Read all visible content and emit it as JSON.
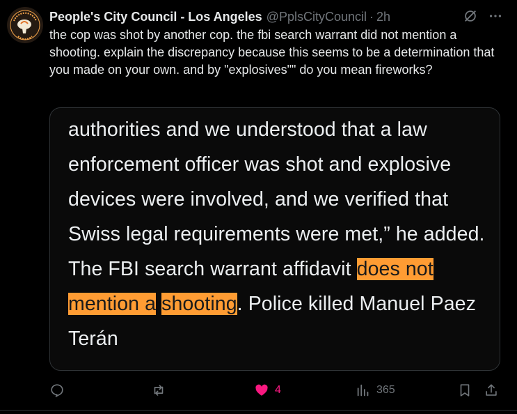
{
  "tweet": {
    "author_name": "People's City Council - Los Angeles",
    "handle": "@PplsCityCouncil",
    "separator": "·",
    "time": "2h",
    "avatar_text_top": "PEOPLE'S CITY COUNCIL",
    "avatar_text_bottom": "LOS ANGELES",
    "body": "the cop was shot by another cop. the fbi search warrant did not mention a shooting. explain the discrepancy because this seems to be a determination that you made on your own. and by \"explosives\"\" do you mean fireworks?"
  },
  "media": {
    "before": "authorities and we understood that a law enforcement officer was shot and explosive devices were involved, and we verified that Swiss legal requirements were met,” he added. The FBI search warrant affidavit ",
    "highlight_1": "does not mention a",
    "space": " ",
    "highlight_2": "shooting",
    "after": ". Police killed Manuel Paez Terán",
    "highlight_color": "#ff9c33"
  },
  "actions": {
    "replies_icon": "reply-icon",
    "retweets_icon": "retweet-icon",
    "likes_icon": "heart-icon",
    "likes_count": "4",
    "views_icon": "views-icon",
    "views_count": "365",
    "bookmark_icon": "bookmark-icon",
    "share_icon": "share-icon",
    "like_color": "#f91880"
  }
}
